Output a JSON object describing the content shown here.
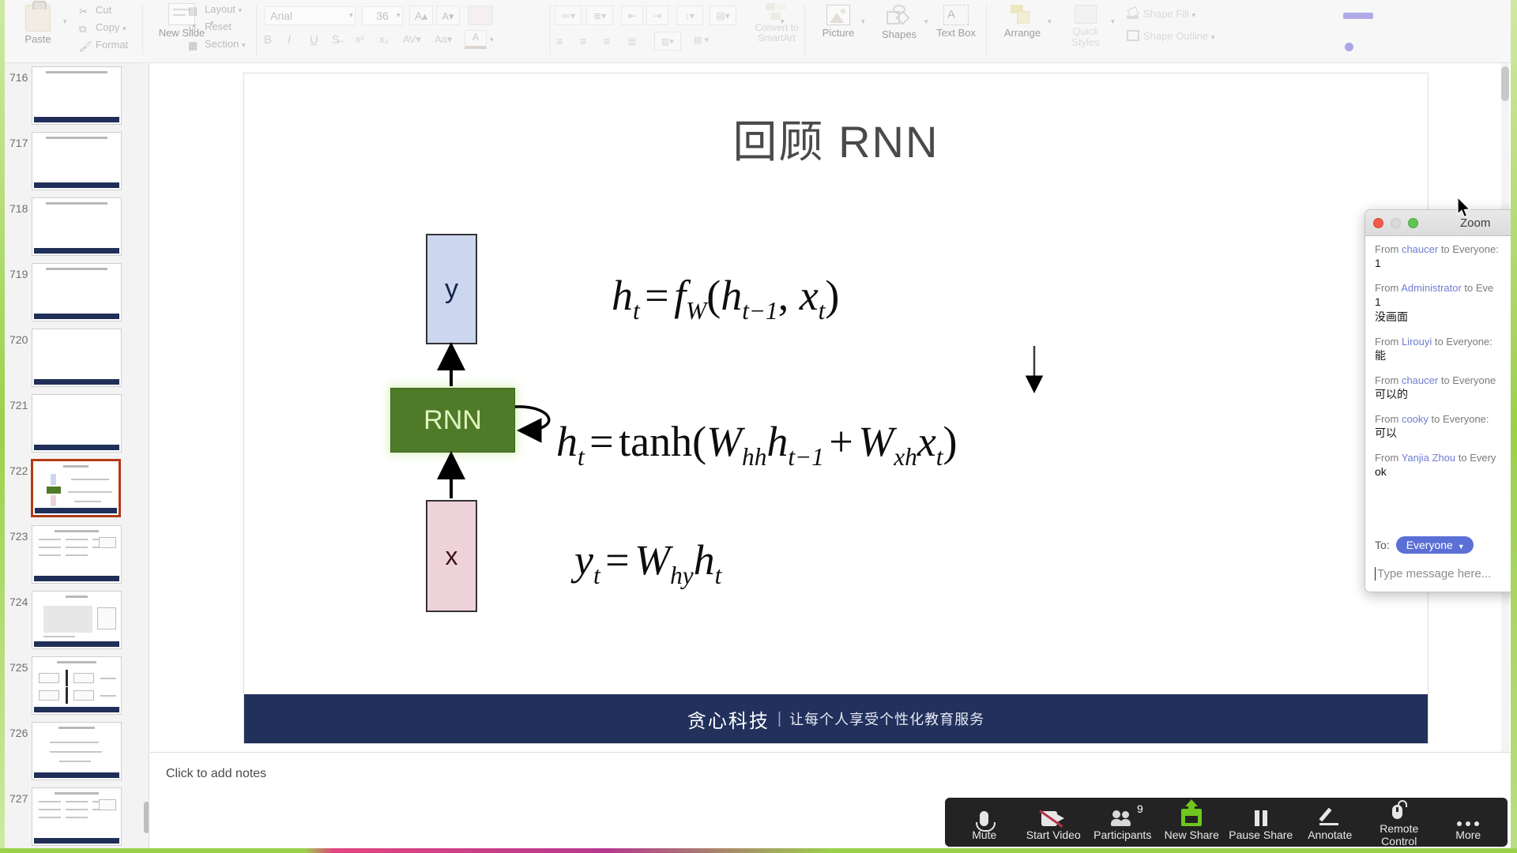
{
  "ribbon": {
    "clipboard": {
      "paste": "Paste",
      "cut": "Cut",
      "copy": "Copy",
      "format": "Format"
    },
    "slides": {
      "new_slide_line1": "New",
      "new_slide_line2": "Slide",
      "layout": "Layout",
      "reset": "Reset",
      "section": "Section"
    },
    "font": {
      "family_value": "Arial",
      "size_value": "36"
    },
    "paragraph": {
      "convert_line1": "Convert to",
      "convert_line2": "SmartArt"
    },
    "insert": {
      "picture": "Picture",
      "shapes": "Shapes",
      "textbox_line1": "Text",
      "textbox_line2": "Box"
    },
    "drawing": {
      "arrange": "Arrange",
      "quick_styles_line1": "Quick",
      "quick_styles_line2": "Styles",
      "shape_fill": "Shape Fill",
      "shape_outline": "Shape Outline"
    }
  },
  "thumbnails": {
    "selected_index": 6,
    "items": [
      {
        "number": "716",
        "kind": "title"
      },
      {
        "number": "717",
        "kind": "title"
      },
      {
        "number": "718",
        "kind": "title"
      },
      {
        "number": "719",
        "kind": "title"
      },
      {
        "number": "720",
        "kind": "blank"
      },
      {
        "number": "721",
        "kind": "blank"
      },
      {
        "number": "722",
        "kind": "rnn"
      },
      {
        "number": "723",
        "kind": "dense"
      },
      {
        "number": "724",
        "kind": "figure"
      },
      {
        "number": "725",
        "kind": "boxes"
      },
      {
        "number": "726",
        "kind": "bullets"
      },
      {
        "number": "727",
        "kind": "dense"
      }
    ]
  },
  "slide": {
    "title": "回顾 RNN",
    "nodes": {
      "output": "y",
      "cell": "RNN",
      "input": "x"
    },
    "equations": [
      {
        "id": "eq1",
        "latex": "h_t = f_W(h_{t-1}, x_t)"
      },
      {
        "id": "eq2",
        "latex": "h_t = tanh(W_hh h_{t-1} + W_xh x_t)"
      },
      {
        "id": "eq3",
        "latex": "y_t = W_hy h_t"
      }
    ],
    "footer": {
      "brand": "贪心科技",
      "separator": "|",
      "tagline": "让每个人享受个性化教育服务",
      "background": "#22305c"
    }
  },
  "notes": {
    "placeholder": "Click to add notes"
  },
  "chat": {
    "window_title": "Zoom",
    "messages": [
      {
        "from_prefix": "From",
        "sender": "chaucer",
        "to": "to Everyone:",
        "text": "1"
      },
      {
        "from_prefix": "From",
        "sender": "Administrator",
        "to": "to Eve",
        "text": "1\n没画面"
      },
      {
        "from_prefix": "From",
        "sender": "Lirouyi",
        "to": "to Everyone:",
        "text": "能"
      },
      {
        "from_prefix": "From",
        "sender": "chaucer",
        "to": "to Everyone",
        "text": "可以的"
      },
      {
        "from_prefix": "From",
        "sender": "cooky",
        "to": "to Everyone:",
        "text": "可以"
      },
      {
        "from_prefix": "From",
        "sender": "Yanjia Zhou",
        "to": "to Every",
        "text": "ok"
      }
    ],
    "to_label": "To:",
    "to_value": "Everyone",
    "input_placeholder": "Type message here...",
    "accent": "#5b6fd6"
  },
  "zoom_toolbar": {
    "items": [
      {
        "label": "Mute",
        "icon": "microphone-icon",
        "badge": ""
      },
      {
        "label": "Start Video",
        "icon": "camera-off-icon",
        "badge": ""
      },
      {
        "label": "Participants",
        "icon": "participants-icon",
        "badge": "9"
      },
      {
        "label": "New Share",
        "icon": "share-screen-icon",
        "badge": ""
      },
      {
        "label": "Pause Share",
        "icon": "pause-icon",
        "badge": ""
      },
      {
        "label": "Annotate",
        "icon": "pencil-icon",
        "badge": ""
      },
      {
        "label": "Remote Control",
        "icon": "mouse-icon",
        "badge": ""
      },
      {
        "label": "More",
        "icon": "ellipsis-icon",
        "badge": ""
      }
    ],
    "background": "#232323"
  },
  "share_border_color": "#9bd14a"
}
